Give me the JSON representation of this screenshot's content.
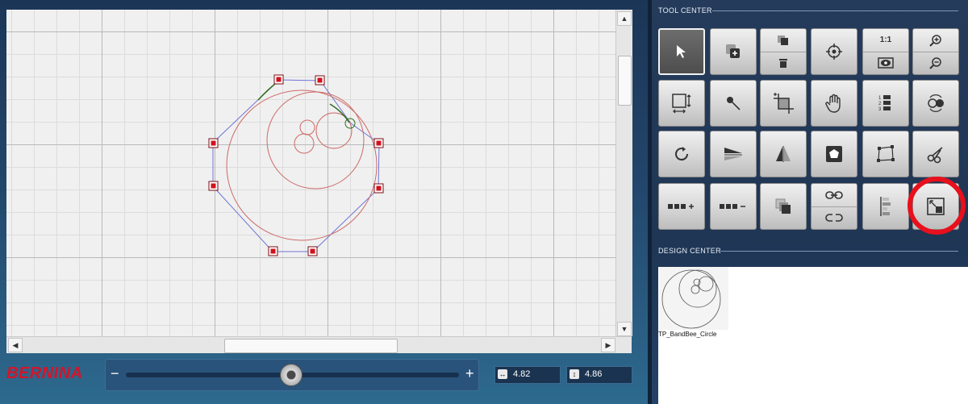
{
  "brand": {
    "logo_text": "BERNINA",
    "logo_color": "#d4142a"
  },
  "canvas": {
    "background": "#f0f0f0",
    "outline_color": "#6f74d6",
    "design_color": "#cc6a66",
    "handle_color": "#d0121e"
  },
  "zoom": {
    "minus_label": "−",
    "plus_label": "+",
    "level": 0.5
  },
  "dimensions": {
    "width": {
      "icon": "horizontal-arrows-icon",
      "value": "4.82"
    },
    "height": {
      "icon": "vertical-arrows-icon",
      "value": "4.86"
    }
  },
  "tool_center": {
    "title": "TOOL CENTER",
    "tools": [
      {
        "name": "select-tool",
        "icon": "arrow-pointer-icon",
        "active": true
      },
      {
        "name": "duplicate-tool",
        "icon": "duplicate-icon"
      },
      {
        "name": "copy-delete-tool",
        "icon": "copy-trash-icon",
        "split": true
      },
      {
        "name": "center-tool",
        "icon": "crosshair-icon"
      },
      {
        "name": "one-to-one-view-tool",
        "icon": "eye-icon",
        "split": true,
        "top_label": "1:1"
      },
      {
        "name": "zoom-tool",
        "icon": "zoom-in-out-icon",
        "split": true
      },
      {
        "name": "resize-tool",
        "icon": "resize-icon"
      },
      {
        "name": "pin-tool",
        "icon": "pin-icon"
      },
      {
        "name": "crop-tool",
        "icon": "crop-icon"
      },
      {
        "name": "pan-tool",
        "icon": "hand-icon"
      },
      {
        "name": "sequence-tool",
        "icon": "numbered-list-icon"
      },
      {
        "name": "color-sort-tool",
        "icon": "circles-refresh-icon"
      },
      {
        "name": "rotate-tool",
        "icon": "rotate-icon"
      },
      {
        "name": "mirror-horizontal-tool",
        "icon": "mirror-horizontal-icon"
      },
      {
        "name": "mirror-vertical-tool",
        "icon": "mirror-vertical-icon"
      },
      {
        "name": "shape-tool",
        "icon": "pentagon-icon"
      },
      {
        "name": "node-edit-tool",
        "icon": "nodes-icon"
      },
      {
        "name": "cut-tool",
        "icon": "scissors-icon"
      },
      {
        "name": "add-points-tool",
        "icon": "add-points-icon"
      },
      {
        "name": "remove-points-tool",
        "icon": "remove-points-icon"
      },
      {
        "name": "layer-order-tool",
        "icon": "layers-icon"
      },
      {
        "name": "link-tool",
        "icon": "link-unlink-icon",
        "split": true
      },
      {
        "name": "align-tool",
        "icon": "align-icon"
      },
      {
        "name": "fit-to-hoop-tool",
        "icon": "expand-corner-icon",
        "highlighted": true
      }
    ]
  },
  "design_center": {
    "title": "DESIGN CENTER",
    "items": [
      {
        "label": "TP_BandBee_Circle"
      }
    ]
  }
}
